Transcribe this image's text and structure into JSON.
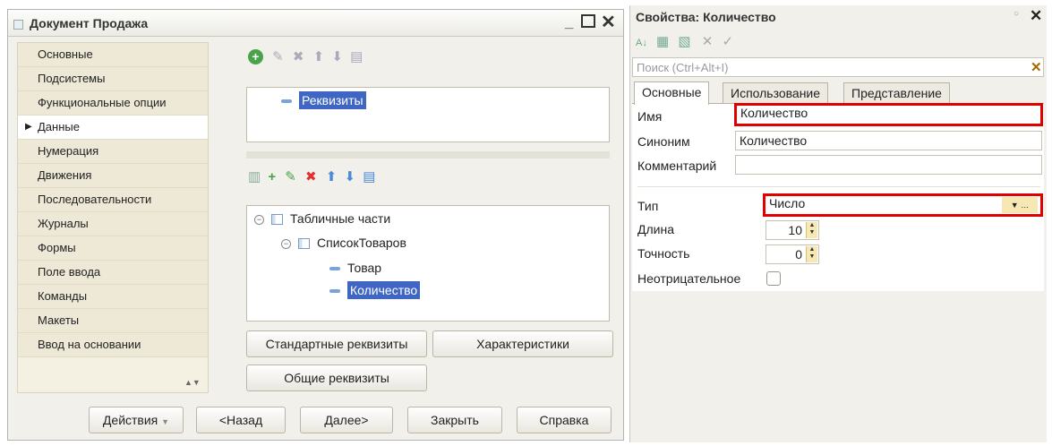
{
  "left_window": {
    "title": "Документ Продажа",
    "nav_items": [
      "Основные",
      "Подсистемы",
      "Функциональные опции",
      "Данные",
      "Нумерация",
      "Движения",
      "Последовательности",
      "Журналы",
      "Формы",
      "Поле ввода",
      "Команды",
      "Макеты",
      "Ввод на основании"
    ],
    "requisites_tree": {
      "item": "Реквизиты"
    },
    "tabular_tree": {
      "root": "Табличные части",
      "table": "СписокТоваров",
      "children": [
        "Товар",
        "Количество"
      ]
    },
    "buttons": {
      "standard_requisites": "Стандартные реквизиты",
      "characteristics": "Характеристики",
      "common_requisites": "Общие реквизиты"
    },
    "bottom_buttons": {
      "actions": "Действия",
      "back": "<Назад",
      "next": "Далее>",
      "close": "Закрыть",
      "help": "Справка"
    }
  },
  "properties": {
    "title": "Свойства: Количество",
    "search_placeholder": "Поиск (Ctrl+Alt+I)",
    "tabs": [
      "Основные",
      "Использование",
      "Представление"
    ],
    "name_label": "Имя",
    "name_value": "Количество",
    "synonym_label": "Синоним",
    "synonym_value": "Количество",
    "comment_label": "Комментарий",
    "comment_value": "",
    "type_label": "Тип",
    "type_value": "Число",
    "length_label": "Длина",
    "length_value": "10",
    "precision_label": "Точность",
    "precision_value": "0",
    "nonnegative_label": "Неотрицательное"
  },
  "colors": {
    "highlight": "#e00000",
    "selection": "#3e66c2"
  }
}
